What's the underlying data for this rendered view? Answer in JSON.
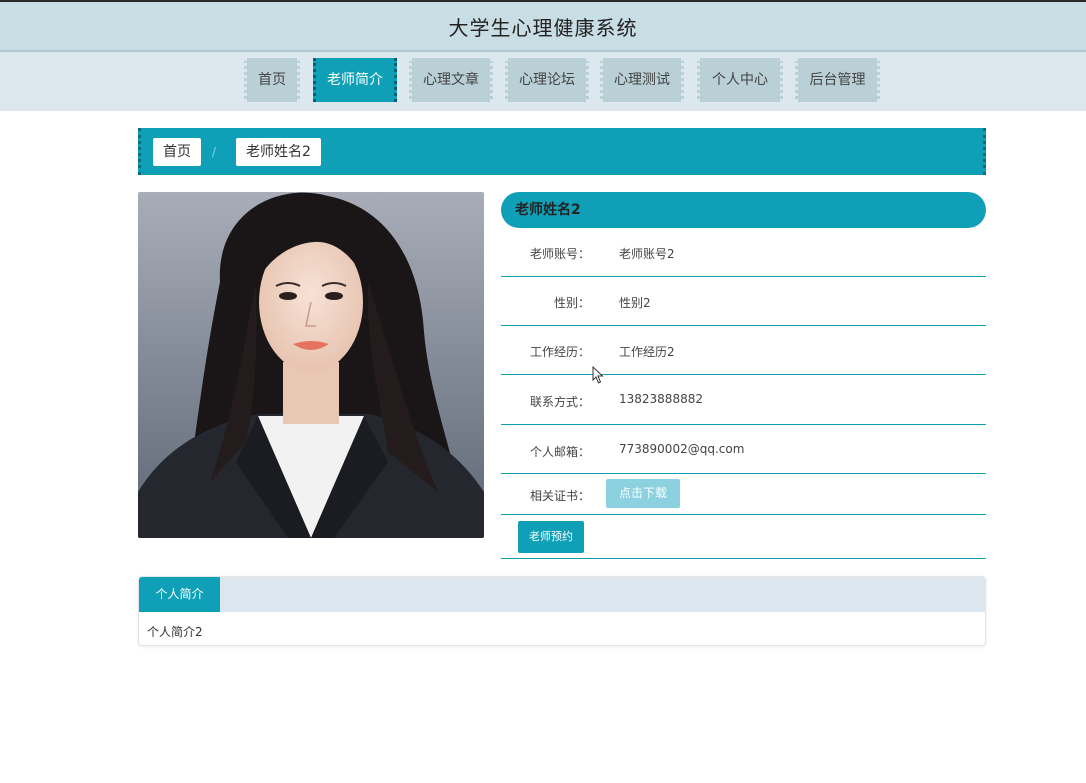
{
  "header": {
    "title": "大学生心理健康系统"
  },
  "nav": {
    "items": [
      {
        "label": "首页"
      },
      {
        "label": "老师简介"
      },
      {
        "label": "心理文章"
      },
      {
        "label": "心理论坛"
      },
      {
        "label": "心理测试"
      },
      {
        "label": "个人中心"
      },
      {
        "label": "后台管理"
      }
    ],
    "active": "老师简介"
  },
  "breadcrumb": {
    "home": "首页",
    "separator": "/",
    "current": "老师姓名2"
  },
  "teacher": {
    "name": "老师姓名2",
    "fields": [
      {
        "label": "老师账号：",
        "value": "老师账号2"
      },
      {
        "label": "性别：",
        "value": "性别2"
      },
      {
        "label": "工作经历：",
        "value": "工作经历2"
      },
      {
        "label": "联系方式：",
        "value": "13823888882"
      },
      {
        "label": "个人邮箱：",
        "value": "773890002@qq.com"
      }
    ],
    "certificate_label": "相关证书：",
    "download_button": "点击下载",
    "book_button": "老师预约"
  },
  "tabs": {
    "items": [
      {
        "label": "个人简介"
      }
    ],
    "content": "个人简介2"
  },
  "colors": {
    "accent": "#0fa0b8",
    "header_bg": "#c9dde4",
    "nav_bg": "#dce7ee",
    "nav_item_bg": "#b8d0d6",
    "download_btn": "#8cd1df"
  }
}
